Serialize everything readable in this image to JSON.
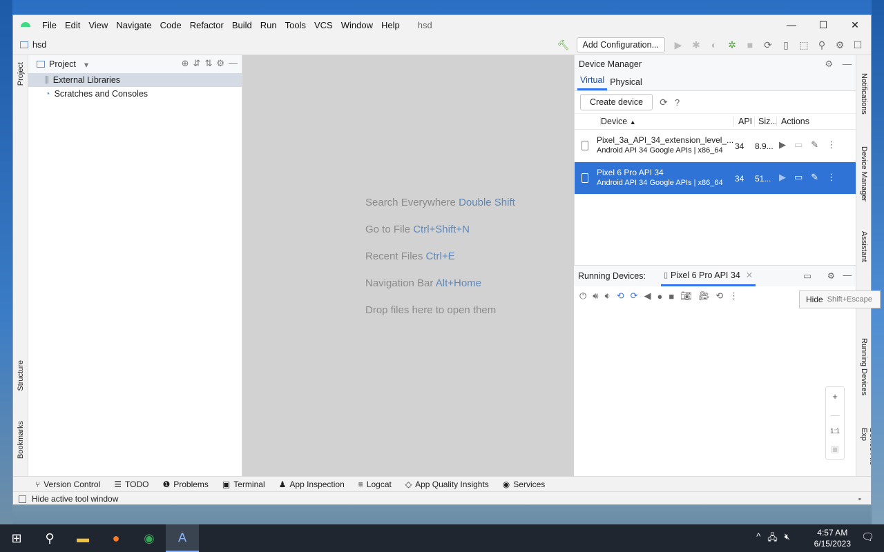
{
  "menu": {
    "items": [
      "File",
      "Edit",
      "View",
      "Navigate",
      "Code",
      "Refactor",
      "Build",
      "Run",
      "Tools",
      "VCS",
      "Window",
      "Help"
    ],
    "project": "hsd"
  },
  "window": {
    "min": "—",
    "max": "☐",
    "close": "✕"
  },
  "toolbar": {
    "breadcrumb": "hsd",
    "add_config": "Add Configuration..."
  },
  "left_strip": {
    "project": "Project",
    "structure": "Structure",
    "bookmarks": "Bookmarks"
  },
  "project_pane": {
    "title": "Project",
    "items": [
      "External Libraries",
      "Scratches and Consoles"
    ]
  },
  "editor": {
    "hints": [
      {
        "label": "Search Everywhere",
        "key": "Double Shift"
      },
      {
        "label": "Go to File",
        "key": "Ctrl+Shift+N"
      },
      {
        "label": "Recent Files",
        "key": "Ctrl+E"
      },
      {
        "label": "Navigation Bar",
        "key": "Alt+Home"
      },
      {
        "label": "Drop files here to open them",
        "key": ""
      }
    ]
  },
  "device_manager": {
    "title": "Device Manager",
    "tabs": [
      "Virtual",
      "Physical"
    ],
    "create_btn": "Create device",
    "columns": {
      "device": "Device",
      "api": "API",
      "size": "Siz...",
      "actions": "Actions"
    },
    "rows": [
      {
        "name": "Pixel_3a_API_34_extension_level_...",
        "sub": "Android API 34 Google APIs | x86_64",
        "api": "34",
        "size": "8.9...",
        "selected": false
      },
      {
        "name": "Pixel 6 Pro API 34",
        "sub": "Android API 34 Google APIs | x86_64",
        "api": "34",
        "size": "51...",
        "selected": true
      }
    ]
  },
  "running_devices": {
    "label": "Running Devices:",
    "tab": "Pixel 6 Pro API 34",
    "zoom_ratio": "1:1"
  },
  "tooltip": {
    "text": "Hide",
    "shortcut": "Shift+Escape"
  },
  "right_strip": {
    "notifications": "Notifications",
    "device_manager": "Device Manager",
    "assistant": "Assistant",
    "running_devices": "Running Devices",
    "device_file": "Device File Exp"
  },
  "bottom_tabs": [
    "Version Control",
    "TODO",
    "Problems",
    "Terminal",
    "App Inspection",
    "Logcat",
    "App Quality Insights",
    "Services"
  ],
  "status": {
    "text": "Hide active tool window"
  },
  "taskbar": {
    "time": "4:57 AM",
    "date": "6/15/2023"
  },
  "colors": {
    "accent": "#3574f0",
    "selected_row": "#2f73d6",
    "editor_bg": "#d2d2d2"
  }
}
